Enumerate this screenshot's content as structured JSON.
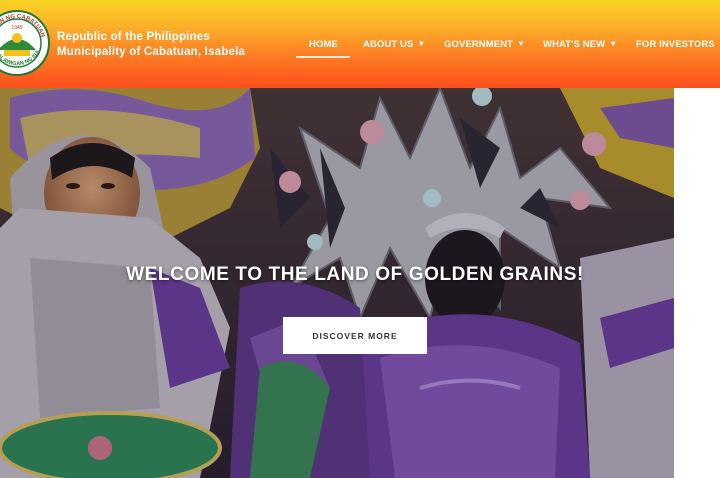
{
  "header": {
    "brand_line1": "Republic of the Philippines",
    "brand_line2": "Municipality of Cabatuan, Isabela",
    "seal_text_top": "BAYAN NG CABATUAN",
    "seal_year": "1949",
    "seal_text_bottom": "LALAWIGAN NG ISABELA"
  },
  "nav": {
    "items": [
      {
        "label": "HOME",
        "active": true
      },
      {
        "label": "ABOUT US"
      },
      {
        "label": "GOVERNMENT"
      },
      {
        "label": "WHAT'S NEW"
      },
      {
        "label": "FOR INVESTORS"
      }
    ],
    "chevron": "▾"
  },
  "hero": {
    "title": "WELCOME TO THE LAND OF GOLDEN GRAINS!",
    "button_label": "DISCOVER MORE"
  },
  "colors": {
    "header_top": "#f9d423",
    "header_bottom": "#ff4e1c",
    "costume_purple": "#6a3fa0"
  }
}
